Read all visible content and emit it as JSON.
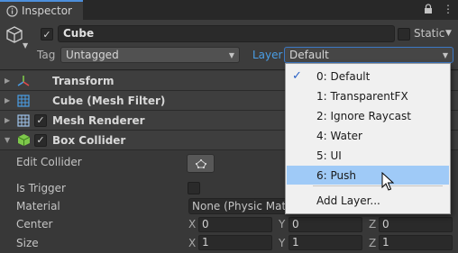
{
  "tab": {
    "title": "Inspector"
  },
  "header": {
    "name": "Cube",
    "static_label": "Static",
    "tag_label": "Tag",
    "tag_value": "Untagged",
    "layer_label": "Layer",
    "layer_value": "Default"
  },
  "components": [
    {
      "title": "Transform",
      "icon": "transform-icon",
      "has_checkbox": false
    },
    {
      "title": "Cube (Mesh Filter)",
      "icon": "mesh-filter-icon",
      "has_checkbox": false
    },
    {
      "title": "Mesh Renderer",
      "icon": "mesh-renderer-icon",
      "has_checkbox": true
    },
    {
      "title": "Box Collider",
      "icon": "box-collider-icon",
      "has_checkbox": true
    }
  ],
  "box_collider": {
    "edit_collider_label": "Edit Collider",
    "is_trigger_label": "Is Trigger",
    "material_label": "Material",
    "material_value": "None (Physic Mate",
    "center_label": "Center",
    "size_label": "Size",
    "axes": [
      "X",
      "Y",
      "Z"
    ],
    "center": [
      "0",
      "0",
      "0"
    ],
    "size": [
      "1",
      "1",
      "1"
    ]
  },
  "layer_menu": {
    "items": [
      "0: Default",
      "1: TransparentFX",
      "2: Ignore Raycast",
      "4: Water",
      "5: UI",
      "6: Push"
    ],
    "checked": "0: Default",
    "highlighted": "6: Push",
    "add_layer": "Add Layer..."
  },
  "colors": {
    "accent": "#4a9ee6",
    "highlight": "#9fcaf7",
    "panel": "#383838"
  }
}
